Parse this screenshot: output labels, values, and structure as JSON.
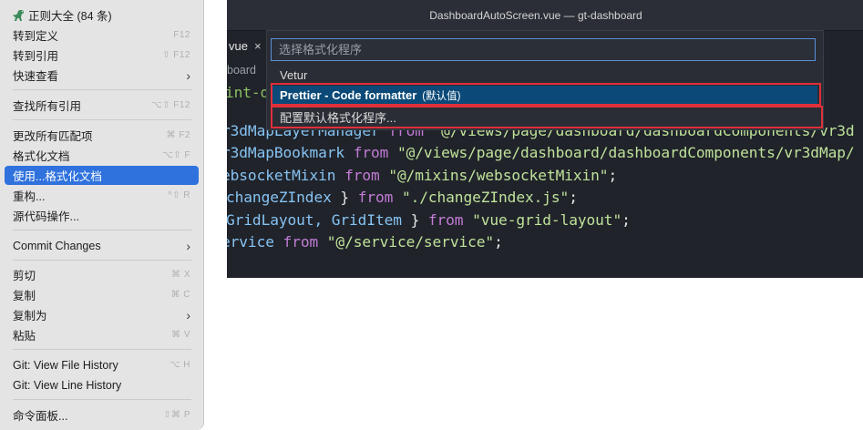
{
  "context_menu": {
    "items": [
      {
        "label": "正则大全 (84 条)",
        "shortcut": ""
      },
      {
        "label": "转到定义",
        "shortcut": "F12"
      },
      {
        "label": "转到引用",
        "shortcut": "⇧ F12"
      },
      {
        "label": "快速查看",
        "shortcut": "",
        "submenu": true
      },
      {
        "label": "查找所有引用",
        "shortcut": "⌥⇧ F12"
      },
      {
        "label": "更改所有匹配项",
        "shortcut": "⌘ F2"
      },
      {
        "label": "格式化文档",
        "shortcut": "⌥⇧ F"
      },
      {
        "label": "使用...格式化文档",
        "shortcut": "",
        "active": true
      },
      {
        "label": "重构...",
        "shortcut": "^⇧ R"
      },
      {
        "label": "源代码操作...",
        "shortcut": ""
      },
      {
        "label": "Commit Changes",
        "shortcut": "",
        "submenu": true
      },
      {
        "label": "剪切",
        "shortcut": "⌘ X"
      },
      {
        "label": "复制",
        "shortcut": "⌘ C"
      },
      {
        "label": "复制为",
        "shortcut": "",
        "submenu": true
      },
      {
        "label": "粘贴",
        "shortcut": "⌘ V"
      },
      {
        "label": "Git: View File History",
        "shortcut": "⌥ H"
      },
      {
        "label": "Git: View Line History",
        "shortcut": ""
      },
      {
        "label": "命令面板...",
        "shortcut": "⇧⌘ P"
      }
    ],
    "submenu_arrow": "›"
  },
  "editor": {
    "window_title": "DashboardAutoScreen.vue — gt-dashboard",
    "tab_label": "vue",
    "tab_close": "×",
    "breadcrumb": "board",
    "code_lines": [
      {
        "partial": "int-d"
      },
      {
        "a": "r3dMapLayerManager",
        "from": "from",
        "path": "\"@/views/page/dashboard/dashboardComponents/vr3d"
      },
      {
        "a": "r3dMapBookmark",
        "from": "from",
        "path": "\"@/views/page/dashboard/dashboardComponents/vr3dMap/"
      },
      {
        "a": "ebsocketMixin",
        "from": "from",
        "path": "\"@/mixins/websocketMixin\"",
        "end": ";"
      },
      {
        "a": "changeZIndex",
        "open": " ",
        "close": " } ",
        "from": "from",
        "path": "\"./changeZIndex.js\"",
        "end": ";"
      },
      {
        "a": "GridLayout, GridItem",
        "close": " } ",
        "from": "from",
        "path": "\"vue-grid-layout\"",
        "end": ";"
      },
      {
        "a": "ervice",
        "from": "from",
        "path": "\"@/service/service\"",
        "end": ";"
      }
    ]
  },
  "quick_pick": {
    "placeholder": "选择格式化程序",
    "options": [
      {
        "label": "Vetur",
        "badge": ""
      },
      {
        "label": "Prettier - Code formatter",
        "badge": "(默认值)",
        "selected": true
      },
      {
        "label": "配置默认格式化程序...",
        "badge": ""
      }
    ]
  },
  "colors": {
    "menu_active": "#2f72dd",
    "quick_pick_selected": "#0b4a78",
    "annotation_box": "#e0303a"
  }
}
